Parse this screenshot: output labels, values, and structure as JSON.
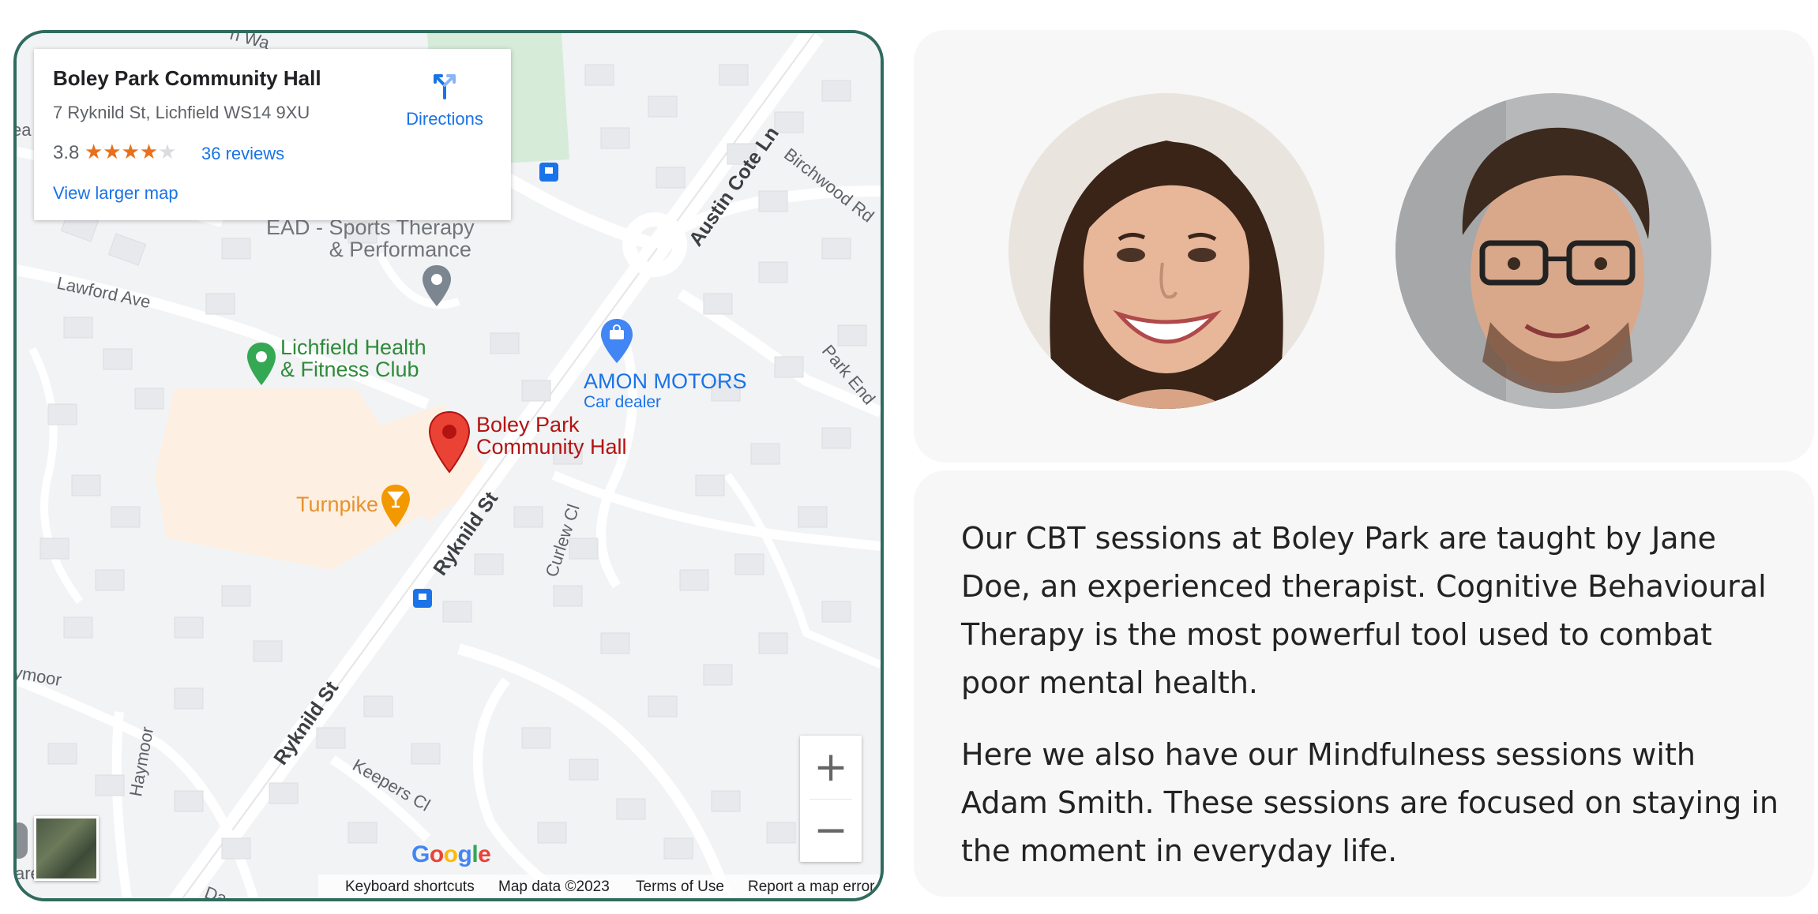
{
  "map": {
    "place_name": "Boley Park Community Hall",
    "address": "7 Ryknild St, Lichfield WS14 9XU",
    "rating": "3.8",
    "stars": "★★★★",
    "star_empty": "★",
    "rating_value": 3.8,
    "reviews": "36 reviews",
    "directions_label": "Directions",
    "view_larger": "View larger map",
    "zoom_in": "+",
    "zoom_out": "−",
    "google_logo": "Google",
    "attribution": {
      "shortcuts": "Keyboard shortcuts",
      "map_data": "Map data ©2023",
      "terms": "Terms of Use",
      "report": "Report a map error"
    },
    "labels": {
      "ead_line1": "EAD - Sports Therapy",
      "ead_line2": "& Performance",
      "lawford": "Lawford Ave",
      "lichfield_line1": "Lichfield Health",
      "lichfield_line2": "& Fitness Club",
      "amon": "AMON MOTORS",
      "car_dealer": "Car dealer",
      "boley_line1": "Boley Park",
      "boley_line2": "Community Hall",
      "turnpike": "Turnpike",
      "ryknild1": "Ryknild St",
      "ryknild2": "Ryknild St",
      "curlew": "Curlew Cl",
      "austin": "Austin Cote Ln",
      "birchwood": "Birchwood Rd",
      "park_end": "Park End",
      "haymoor": "Haymoor",
      "keepers": "Keepers Cl",
      "ymoor": "ymoor",
      "are": "are",
      "da": "Da",
      "ea": "ea",
      "top_w": "n Wa"
    },
    "colors": {
      "border": "#2f6b5e",
      "marker": "#ea4335",
      "link": "#1a73e8",
      "green_poi": "#2e8b3a",
      "orange_poi": "#e8912d",
      "star": "#e7711b"
    }
  },
  "content": {
    "paragraph1": "Our CBT sessions at Boley Park are taught by Jane Doe, an experienced therapist. Cognitive Behavioural Therapy is the most powerful tool used to combat poor mental health.",
    "paragraph2": "Here we also have our Mindfulness sessions with Adam Smith. These sessions are focused on staying in the moment in everyday life."
  }
}
